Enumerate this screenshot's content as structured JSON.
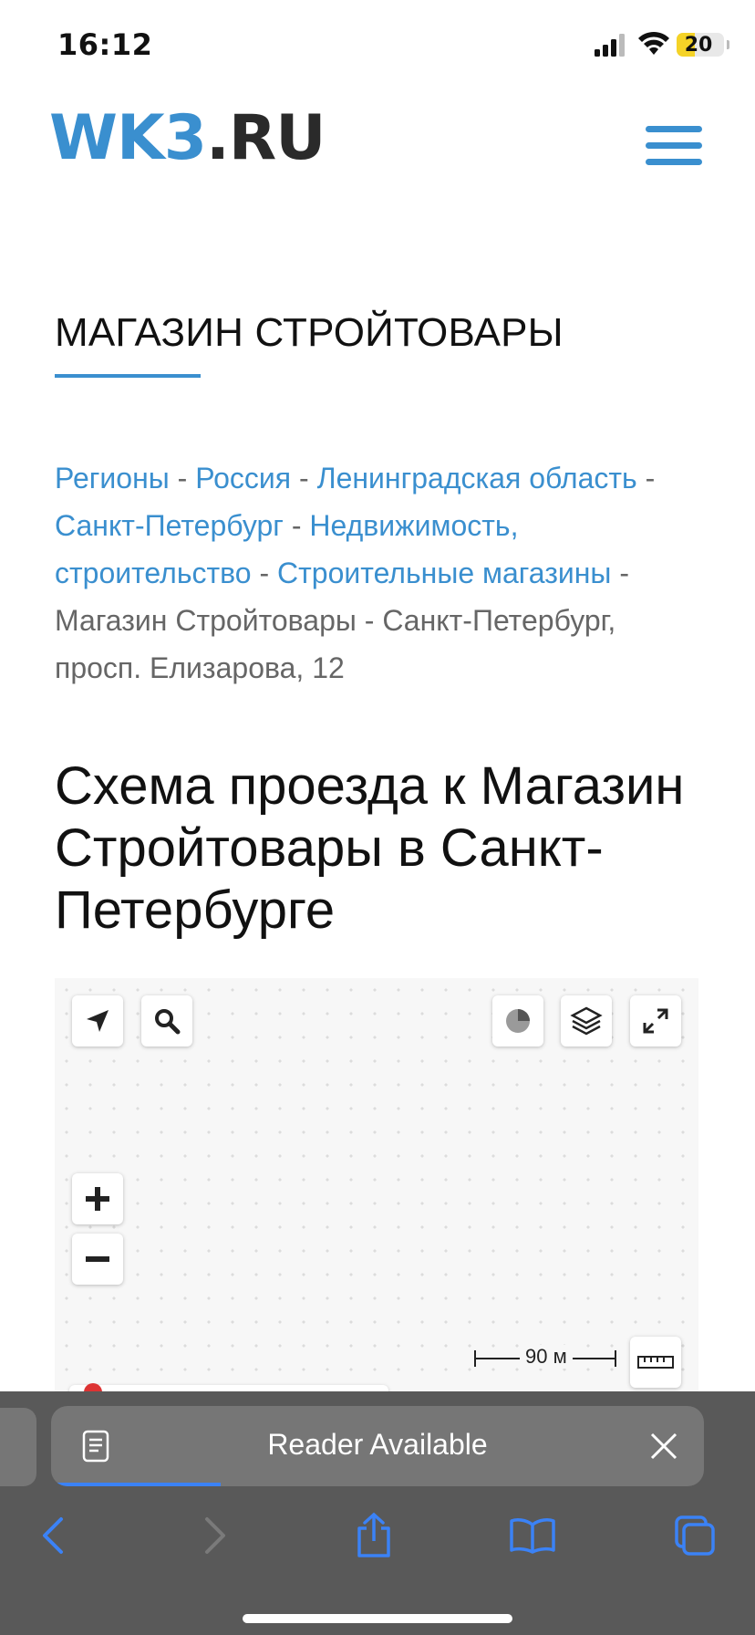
{
  "status_bar": {
    "time": "16:12",
    "battery": "20"
  },
  "header": {
    "logo_part1": "WK3",
    "logo_part2": ".RU"
  },
  "page_title": "МАГАЗИН СТРОЙТОВАРЫ",
  "breadcrumbs": {
    "links": [
      "Регионы",
      "Россия",
      "Ленинградская область",
      "Санкт-Петербург",
      "Недвижимость, строительство",
      "Строительные магазины"
    ],
    "current": "Магазин Стройтовары - Санкт-Петербург, просп. Елизарова, 12",
    "separator": "-"
  },
  "heading": "Схема проезда к Магазин Стройтовары в Санкт-Петербурге",
  "map": {
    "scale_label": "90 м"
  },
  "safari": {
    "reader_label": "Reader Available",
    "reader_progress": 0.26
  },
  "colors": {
    "accent": "#3a8fcf",
    "safari_bar": "#595959",
    "safari_blue": "#3b82f6"
  }
}
